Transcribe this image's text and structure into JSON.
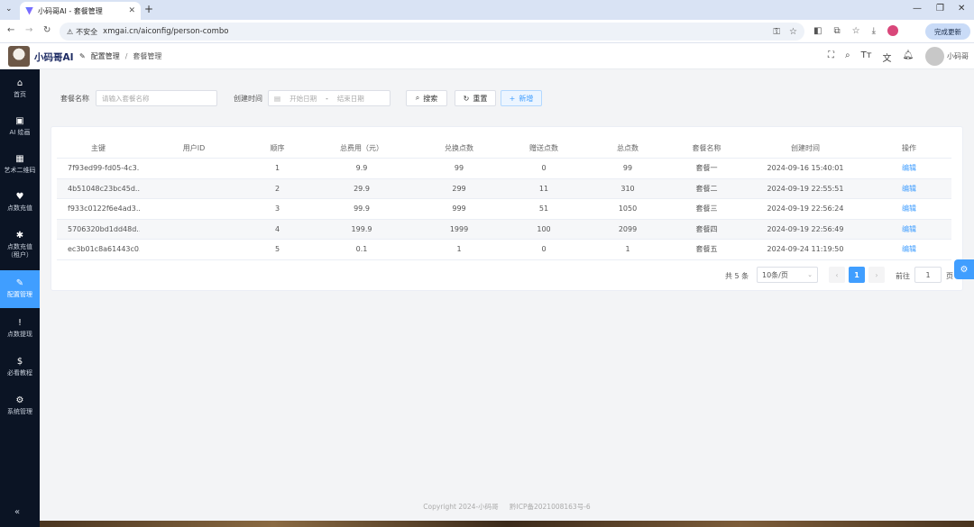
{
  "browser": {
    "tab_title": "小码哥AI - 套餐管理",
    "url": "xmgai.cn/aiconfig/person-combo",
    "security_label": "不安全",
    "update_label": "完成更新"
  },
  "header": {
    "brand": "小码哥AI",
    "breadcrumb": [
      "配置管理",
      "套餐管理"
    ],
    "user_name": "小码哥"
  },
  "sidebar": {
    "items": [
      {
        "label": "首页",
        "icon": "home-icon"
      },
      {
        "label": "AI 绘画",
        "icon": "ai-icon"
      },
      {
        "label": "艺术二维码",
        "icon": "qrcode-icon"
      },
      {
        "label": "点数充值",
        "icon": "heart-icon"
      },
      {
        "label": "点数充值（租户）",
        "icon": "asterisk-icon"
      },
      {
        "label": "配置管理",
        "icon": "pencil-icon"
      },
      {
        "label": "点数提现",
        "icon": "exclamation-icon"
      },
      {
        "label": "必看教程",
        "icon": "dollar-icon"
      },
      {
        "label": "系统管理",
        "icon": "gear-icon"
      }
    ],
    "active_index": 5
  },
  "search": {
    "name_label": "套餐名称",
    "name_placeholder": "请输入套餐名称",
    "date_label": "创建时间",
    "start_placeholder": "开始日期",
    "range_sep": "-",
    "end_placeholder": "结束日期",
    "search_btn": "搜索",
    "reset_btn": "重置",
    "add_btn": "新增"
  },
  "table": {
    "columns": [
      "主键",
      "用户ID",
      "顺序",
      "总费用（元）",
      "兑换点数",
      "赠送点数",
      "总点数",
      "套餐名称",
      "创建时间",
      "操作"
    ],
    "rows": [
      {
        "id": "7f93ed99-fd05-4c3...",
        "user_id": "",
        "order": "1",
        "fee": "9.9",
        "points": "99",
        "bonus": "0",
        "total": "99",
        "name": "套餐一",
        "created": "2024-09-16 15:40:01",
        "action": "编辑"
      },
      {
        "id": "4b51048c23bc45d...",
        "user_id": "",
        "order": "2",
        "fee": "29.9",
        "points": "299",
        "bonus": "11",
        "total": "310",
        "name": "套餐二",
        "created": "2024-09-19 22:55:51",
        "action": "编辑"
      },
      {
        "id": "f933c0122f6e4ad3...",
        "user_id": "",
        "order": "3",
        "fee": "99.9",
        "points": "999",
        "bonus": "51",
        "total": "1050",
        "name": "套餐三",
        "created": "2024-09-19 22:56:24",
        "action": "编辑"
      },
      {
        "id": "5706320bd1dd48d...",
        "user_id": "",
        "order": "4",
        "fee": "199.9",
        "points": "1999",
        "bonus": "100",
        "total": "2099",
        "name": "套餐四",
        "created": "2024-09-19 22:56:49",
        "action": "编辑"
      },
      {
        "id": "ec3b01c8a61443c0...",
        "user_id": "",
        "order": "5",
        "fee": "0.1",
        "points": "1",
        "bonus": "0",
        "total": "1",
        "name": "套餐五",
        "created": "2024-09-24 11:19:50",
        "action": "编辑"
      }
    ]
  },
  "pagination": {
    "total": "共 5 条",
    "page_size": "10条/页",
    "current": "1",
    "goto_label": "前往",
    "goto_value": "1",
    "page_suffix": "页"
  },
  "footer": {
    "copyright": "Copyright 2024-小码哥",
    "icp": "黔ICP备2021008163号-6"
  },
  "colors": {
    "accent": "#409eff",
    "sidebar_bg": "#0b1424",
    "brand": "#1d2b63"
  }
}
